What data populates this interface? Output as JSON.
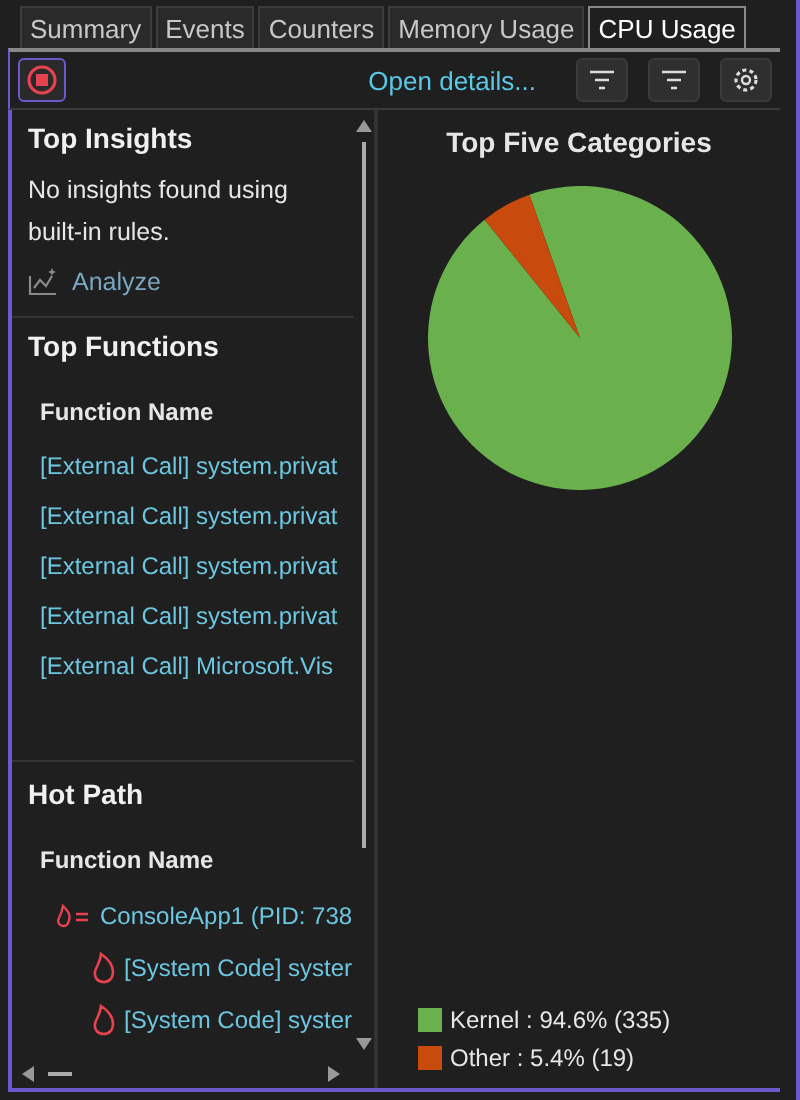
{
  "tabs": [
    {
      "label": "Summary",
      "selected": false
    },
    {
      "label": "Events",
      "selected": false
    },
    {
      "label": "Counters",
      "selected": false
    },
    {
      "label": "Memory Usage",
      "selected": false
    },
    {
      "label": "CPU Usage",
      "selected": true
    }
  ],
  "toolbar": {
    "open_details": "Open details..."
  },
  "insights": {
    "title": "Top Insights",
    "message": "No insights found using built-in rules.",
    "analyze": "Analyze"
  },
  "top_functions": {
    "title": "Top Functions",
    "column": "Function Name",
    "rows": [
      "[External Call] system.privat",
      "[External Call] system.privat",
      "[External Call] system.privat",
      "[External Call] system.privat",
      "[External Call] Microsoft.Vis"
    ]
  },
  "hot_path": {
    "title": "Hot Path",
    "column": "Function Name",
    "items": [
      {
        "label": "ConsoleApp1 (PID: 738",
        "kind": "process",
        "children": [
          {
            "label": "[System Code] syster",
            "kind": "hot"
          },
          {
            "label": "[System Code] syster",
            "kind": "hot"
          }
        ]
      }
    ]
  },
  "categories": {
    "title": "Top Five Categories",
    "chart_data": {
      "type": "pie",
      "categories": [
        "Kernel",
        "Other"
      ],
      "values": [
        94.6,
        5.4
      ]
    },
    "legend": [
      {
        "reading": ": 94.6% (335)",
        "color": "#6ab04c"
      },
      {
        "reading": ": 5.4% (19)",
        "color": "#c84a0c"
      }
    ]
  }
}
